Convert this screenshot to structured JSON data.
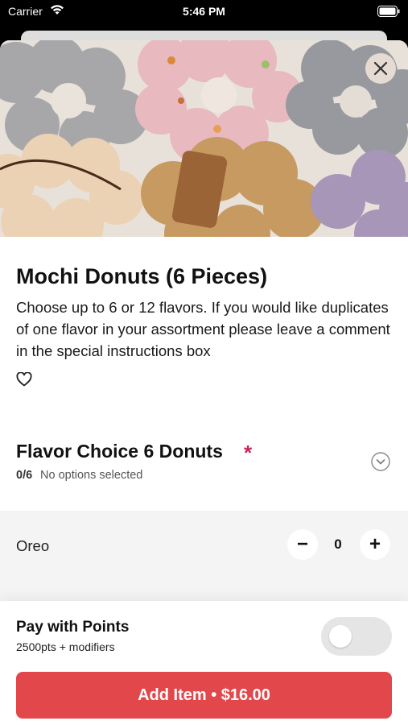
{
  "status_bar": {
    "carrier": "Carrier",
    "time": "5:46 PM",
    "icons": [
      "wifi-icon",
      "battery-icon"
    ]
  },
  "hero_image": {
    "description_icon": "mochi-donuts-photo"
  },
  "item": {
    "title": "Mochi Donuts (6 Pieces)",
    "description": "Choose up to 6 or 12 flavors. If you would like duplicates of one flavor in your assortment please leave a comment in the special instructions box"
  },
  "flavor_section": {
    "title": "Flavor Choice 6 Donuts",
    "required_mark": "*",
    "count": "0/6",
    "status": "No options selected"
  },
  "options": [
    {
      "label": "Oreo",
      "quantity": "0",
      "minus": "−",
      "plus": "+"
    }
  ],
  "footer": {
    "points_title": "Pay with Points",
    "points_subtitle": "2500pts + modifiers",
    "points_enabled": false,
    "add_button_label": "Add Item • $16.00"
  },
  "colors": {
    "accent": "#e2474b",
    "required": "#c8265a",
    "toggle_off": "#e5e5e5"
  }
}
